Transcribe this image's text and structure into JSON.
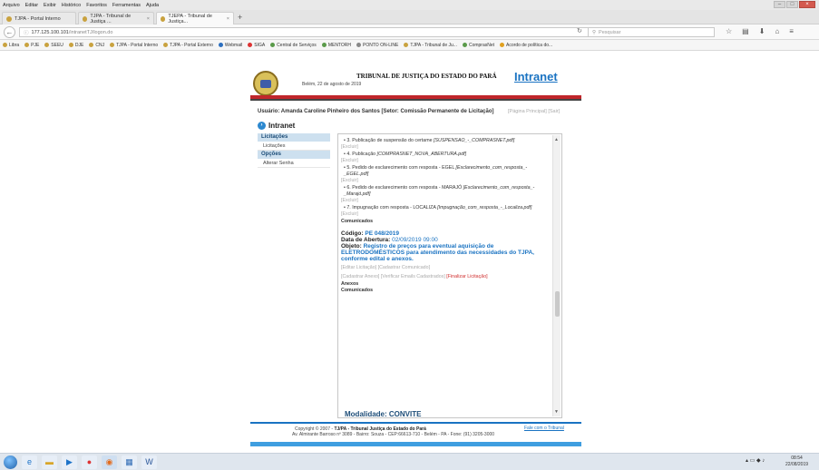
{
  "menubar": [
    "Arquivo",
    "Editar",
    "Exibir",
    "Histórico",
    "Favoritos",
    "Ferramentas",
    "Ajuda"
  ],
  "tabs": [
    {
      "label": "TJPA - Portal Interno"
    },
    {
      "label": "TJPA - Tribunal de Justiça ..."
    },
    {
      "label": "TJEPA - Tribunal de Justiça..."
    }
  ],
  "url": {
    "host": "177.125.100.101",
    "path": "/intranetTJ/logon.do"
  },
  "search_placeholder": "Pesquisar",
  "bookmarks": [
    "Libra",
    "PJE",
    "SEEU",
    "DJE",
    "CNJ",
    "TJPA - Portal Interno",
    "TJPA - Portal Externo",
    "Webmail",
    "SIGA",
    "Central de Serviços",
    "MENTORH",
    "PONTO ON-LINE",
    "TJPA - Tribunal de Ju...",
    "ComprasNet",
    "Acordo de política do..."
  ],
  "header": {
    "court_name": "TRIBUNAL DE JUSTIÇA DO ESTADO DO PARÁ",
    "date": "Belém, 22 de agosto de 2019",
    "logo": "Intranet"
  },
  "userbar": {
    "user_label": "Usuário: Amanda Caroline Pinheiro dos Santos [Setor: Comissão Permanente de Licitação]",
    "links": "[Página Principal]  [Sair]"
  },
  "section_title": "Intranet",
  "sidebar": {
    "group1": "Licitações",
    "item1": "Licitações",
    "group2": "Opções",
    "item2": "Alterar Senha"
  },
  "content": {
    "docs": [
      {
        "text": "• 3. Publicação de suspensão do certame ",
        "file": "[SUSPENSÃO_-_COMPRASNET.pdf]",
        "excluir": "[Excluir]"
      },
      {
        "text": "• 4. Publicação ",
        "file": "[COMPRASNET_NOVA_ABERTURA.pdf]",
        "excluir": "[Excluir]"
      },
      {
        "text": "• 5. Pedido de esclarecimento com resposta - EGEL ",
        "file": "[Esclarecimento_com_resposta_-_EGEL.pdf]",
        "excluir": "[Excluir]"
      },
      {
        "text": "• 6. Pedido de esclarecimento com resposta - MARAJÓ ",
        "file": "[Esclarecimento_com_resposta_-_Marajó.pdf]",
        "excluir": "[Excluir]"
      },
      {
        "text": "• 7. Impugnação com resposta - LOCALIZA ",
        "file": "[Impugnação_com_resposta_-_Localiza.pdf]",
        "excluir": "[Excluir]"
      }
    ],
    "comunicados1": "Comunicados",
    "codigo_label": "Código: ",
    "codigo_value": "PE 048/2019",
    "abertura_label": "Data de Abertura: ",
    "abertura_value": "02/09/2019 09:00",
    "objeto_label": "Objeto: ",
    "objeto_value": "Registro de preços para eventual aquisição de ELETRODOMÉSTICOS para atendimento das necessidades do TJPA, conforme edital e anexos.",
    "links1": "[Editar Licitação]  [Cadastrar Comunicado]",
    "links2a": "[Cadastrar Anexo]  [Verificar Emails Cadastrados]  ",
    "links2b": "[Finalizar Licitação]",
    "anexos": "Anexos",
    "comunicados2": "Comunicados",
    "modalidade": "Modalidade: CONVITE",
    "scroll_position": 0.62
  },
  "footer": {
    "copy_prefix": "Copyright © 2007 - ",
    "copy_bold": "TJ/PA - Tribunal Justiça do Estado do Pará",
    "contact": "Fale com o Tribunal",
    "address": "Av. Almirante Barroso nº 3089 - Bairro: Souza - CEP:66613-710 - Belém - PA - Fone: (91) 3205-3000"
  },
  "taskbar": {
    "clock_time": "08:54",
    "clock_date": "22/08/2019"
  },
  "colors": {
    "accent": "#1a73c2",
    "brand_red": "#c0262b",
    "link_red": "#d02f2f"
  }
}
